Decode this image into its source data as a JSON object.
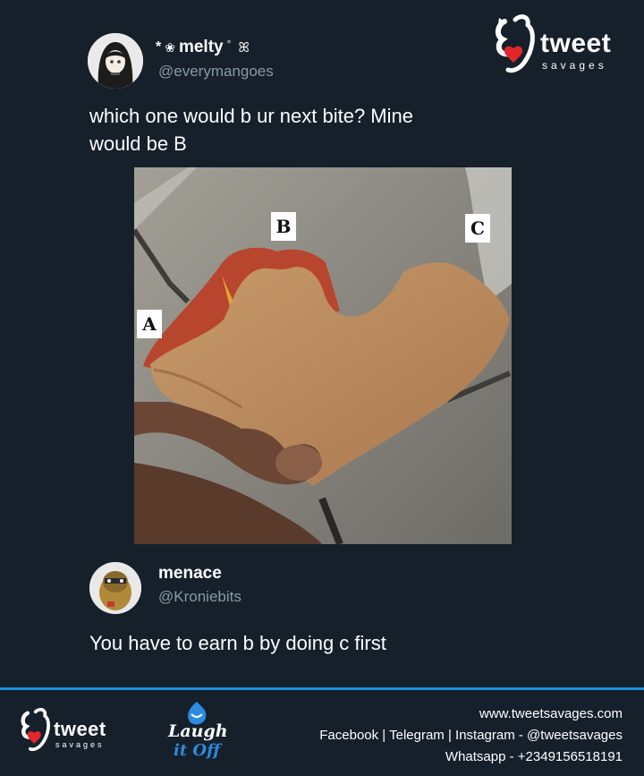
{
  "brand": {
    "logo_word": "tweet",
    "logo_sub": "savages",
    "footer_logo_word": "tweet",
    "footer_logo_sub": "savages",
    "laugh_logo_line1": "Laugh",
    "laugh_logo_line2": "it Off"
  },
  "post": {
    "display_name": "melty",
    "handle": "@everymangoes",
    "text_line1": "which one would b ur next bite? Mine",
    "text_line2": "would be B",
    "image_labels": [
      "A",
      "B",
      "C"
    ]
  },
  "reply": {
    "display_name": "menace",
    "handle": "@Kroniebits",
    "text": "You have to earn b by doing c first"
  },
  "footer": {
    "website": "www.tweetsavages.com",
    "socials": "Facebook | Telegram | Instagram - @tweetsavages",
    "whatsapp": "Whatsapp - +2349156518191"
  },
  "colors": {
    "background": "#15202b",
    "divider": "#1d8fe0",
    "handle": "#8899a6"
  }
}
